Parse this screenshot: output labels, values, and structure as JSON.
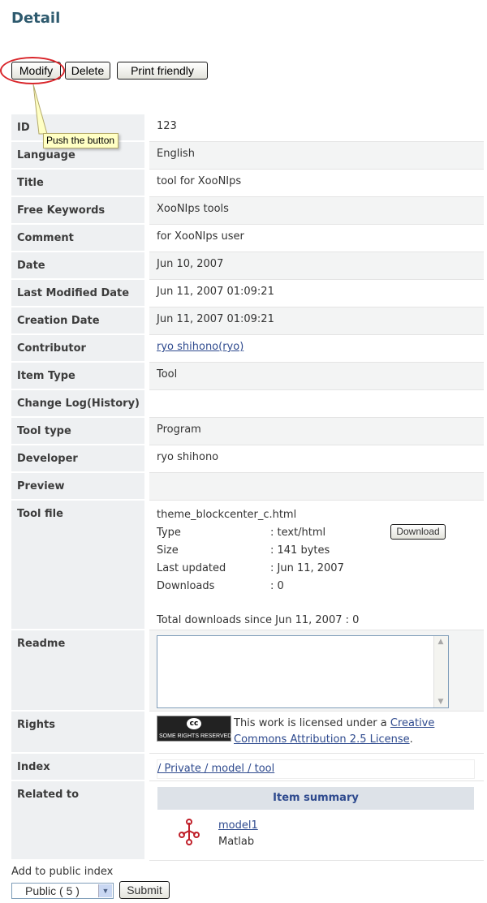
{
  "page": {
    "title": "Detail"
  },
  "toolbar": {
    "modify": "Modify",
    "delete": "Delete",
    "print": "Print friendly"
  },
  "tooltip": "Push the button",
  "fields": {
    "id": {
      "label": "ID",
      "value": "123"
    },
    "language": {
      "label": "Language",
      "value": "English"
    },
    "title": {
      "label": "Title",
      "value": "tool for XooNIps"
    },
    "keywords": {
      "label": "Free Keywords",
      "value": "XooNIps tools"
    },
    "comment": {
      "label": "Comment",
      "value": "for XooNIps user"
    },
    "date": {
      "label": "Date",
      "value": "Jun 10, 2007"
    },
    "last_modified": {
      "label": "Last Modified Date",
      "value": "Jun 11, 2007 01:09:21"
    },
    "creation": {
      "label": "Creation Date",
      "value": "Jun 11, 2007 01:09:21"
    },
    "contributor": {
      "label": "Contributor",
      "value": "ryo shihono(ryo)"
    },
    "item_type": {
      "label": "Item Type",
      "value": "Tool"
    },
    "change_log": {
      "label": "Change Log(History)",
      "value": ""
    },
    "tool_type": {
      "label": "Tool type",
      "value": "Program"
    },
    "developer": {
      "label": "Developer",
      "value": "ryo shihono"
    },
    "preview": {
      "label": "Preview",
      "value": ""
    },
    "tool_file": {
      "label": "Tool file",
      "filename": "theme_blockcenter_c.html",
      "type_key": "Type",
      "type_val": ": text/html",
      "size_key": "Size",
      "size_val": ": 141 bytes",
      "updated_key": "Last updated",
      "updated_val": ": Jun 11, 2007",
      "downloads_key": "Downloads",
      "downloads_val": ": 0",
      "total": "Total downloads since Jun 11, 2007 : 0",
      "download_button": "Download"
    },
    "readme": {
      "label": "Readme",
      "value": ""
    },
    "rights": {
      "label": "Rights",
      "badge_text": "SOME RIGHTS RESERVED",
      "badge_logo": "cc",
      "text_prefix": "This work is licensed under a ",
      "link": "Creative Commons Attribution 2.5 License",
      "text_suffix": "."
    },
    "index": {
      "label": "Index",
      "value": "/ Private / model / tool"
    },
    "related": {
      "label": "Related to",
      "summary_header": "Item summary",
      "item_title": "model1",
      "item_sub": "Matlab",
      "icon": "model-molecule-icon"
    }
  },
  "public_index": {
    "label": "Add to public index",
    "select_value": "Public ( 5 )",
    "submit": "Submit"
  },
  "colors": {
    "accent": "#2e5a6e",
    "link": "#2e4a8e",
    "highlight": "#d9252a",
    "label_bg": "#eef0f2"
  }
}
